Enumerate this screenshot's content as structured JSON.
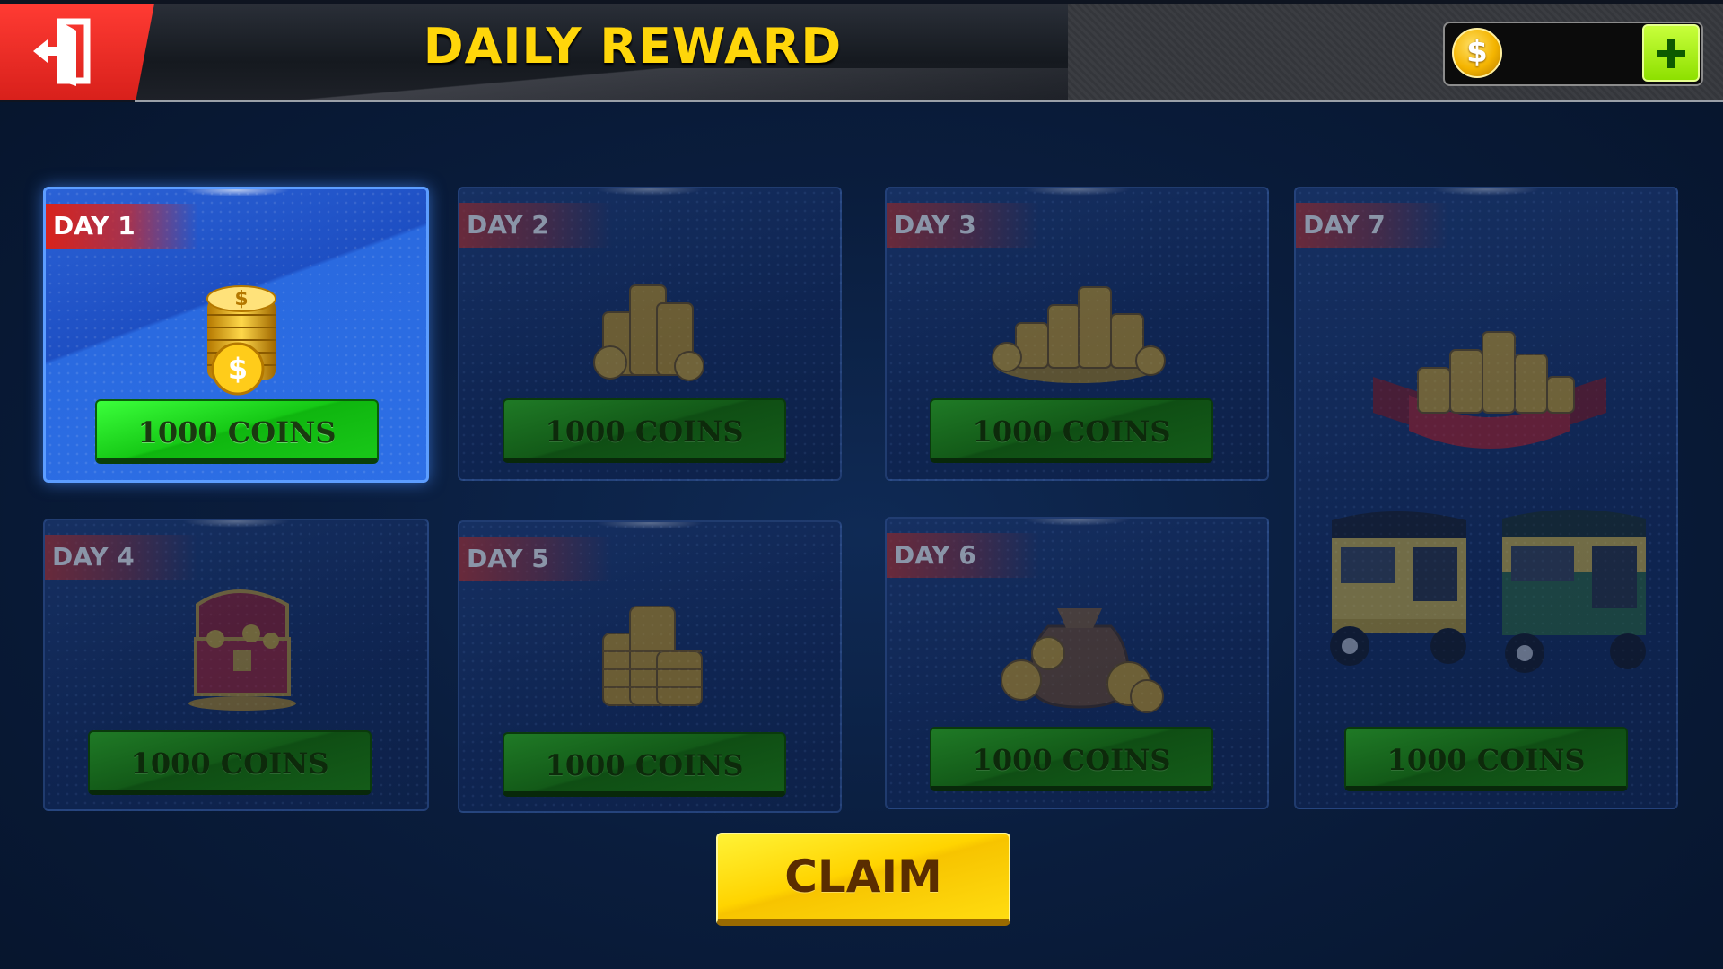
{
  "header": {
    "title": "DAILY REWARD",
    "coin_count": ""
  },
  "days": [
    {
      "label": "DAY 1",
      "reward": "1000 COINS",
      "icon": "coin-stack-icon",
      "active": true
    },
    {
      "label": "DAY 2",
      "reward": "1000 COINS",
      "icon": "coin-piles-icon",
      "active": false
    },
    {
      "label": "DAY 3",
      "reward": "1000 COINS",
      "icon": "coin-heap-icon",
      "active": false
    },
    {
      "label": "DAY 4",
      "reward": "1000 COINS",
      "icon": "treasure-chest-icon",
      "active": false
    },
    {
      "label": "DAY 5",
      "reward": "1000 COINS",
      "icon": "coin-towers-icon",
      "active": false
    },
    {
      "label": "DAY 6",
      "reward": "1000 COINS",
      "icon": "coin-bag-icon",
      "active": false
    },
    {
      "label": "DAY 7",
      "reward": "1000 COINS",
      "icon": "coins-and-rickshaws-icon",
      "active": false
    }
  ],
  "claim_label": "CLAIM",
  "colors": {
    "title": "#ffd60a",
    "active_card": "#2b62d6",
    "active_button": "#16c916",
    "claim_button": "#ffd400",
    "day_label": "#d8231c",
    "exit_button": "#e02a22"
  }
}
